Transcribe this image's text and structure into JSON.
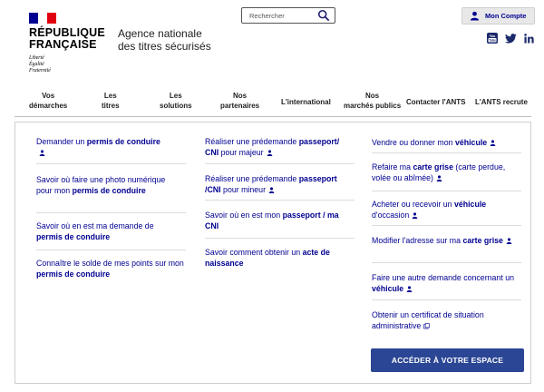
{
  "header": {
    "flag_colors": [
      "#000091",
      "#ffffff",
      "#e1000f"
    ],
    "rf_line1": "RÉPUBLIQUE",
    "rf_line2": "FRANÇAISE",
    "motto": [
      "Liberté",
      "Égalité",
      "Fraternité"
    ],
    "agency_line1": "Agence nationale",
    "agency_line2": "des titres sécurisés",
    "search_placeholder": "Rechercher",
    "account_label": "Mon Compte",
    "socials": [
      "youtube-icon",
      "twitter-icon",
      "linkedin-icon"
    ],
    "accent": "#000091"
  },
  "nav": [
    {
      "line1": "Vos",
      "line2": "démarches"
    },
    {
      "line1": "Les",
      "line2": "titres"
    },
    {
      "line1": "Les",
      "line2": "solutions"
    },
    {
      "line1": "Nos",
      "line2": "partenaires"
    },
    {
      "line1": "L'international",
      "line2": ""
    },
    {
      "line1": "Nos",
      "line2": "marchés publics"
    },
    {
      "line1": "Contacter l'ANTS",
      "line2": ""
    },
    {
      "line1": "L'ANTS recrute",
      "line2": ""
    }
  ],
  "columns": [
    [
      {
        "pre": "Demander un ",
        "bold": "permis de conduire",
        "post": "",
        "icon": "person"
      },
      {
        "pre": "Savoir où faire une photo numérique pour mon ",
        "bold": "permis de conduire",
        "post": "",
        "icon": ""
      },
      {
        "pre": "Savoir où en est ma demande de ",
        "bold": "permis de conduire",
        "post": "",
        "icon": ""
      },
      {
        "pre": "Connaître le solde de mes points sur mon ",
        "bold": "permis de conduire",
        "post": "",
        "icon": ""
      }
    ],
    [
      {
        "pre": "Réaliser une prédemande ",
        "bold": "passeport/ CNI",
        "post": " pour majeur",
        "icon": "person"
      },
      {
        "pre": "Réaliser une prédemande ",
        "bold": "passeport /CNI",
        "post": " pour mineur",
        "icon": "person"
      },
      {
        "pre": "Savoir où en est mon ",
        "bold": "passeport / ma CNI",
        "post": "",
        "icon": ""
      },
      {
        "pre": "Savoir comment obtenir un ",
        "bold": "acte de naissance",
        "post": "",
        "icon": ""
      }
    ],
    [
      {
        "pre": "Vendre ou donner mon ",
        "bold": "véhicule",
        "post": "",
        "icon": "person"
      },
      {
        "pre": "Refaire ma ",
        "bold": "carte grise",
        "post": " (carte perdue, volée ou abîmée)",
        "icon": "person"
      },
      {
        "pre": "Acheter ou recevoir un ",
        "bold": "véhicule",
        "post": " d'occasion",
        "icon": "person"
      },
      {
        "pre": "Modifier l'adresse sur ma ",
        "bold": "carte grise",
        "post": "",
        "icon": "person"
      },
      {
        "pre": "Faire une autre demande concernant un ",
        "bold": "véhicule",
        "post": "",
        "icon": "person"
      },
      {
        "pre": "Obtenir un certificat de situation administrative",
        "bold": "",
        "post": "",
        "icon": "external"
      }
    ]
  ],
  "cta_label": "ACCÉDER À VOTRE ESPACE"
}
